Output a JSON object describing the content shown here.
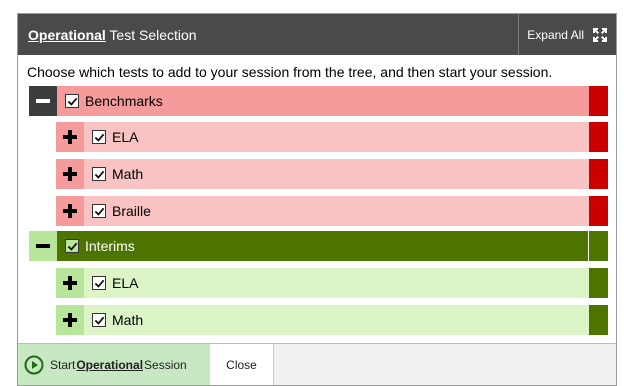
{
  "header": {
    "title_emphasis": "Operational",
    "title_rest": " Test Selection",
    "expand_all_label": "Expand All",
    "expand_icon": "expand-icon"
  },
  "instructions": "Choose which tests to add to your session from the tree, and then start your session.",
  "tree": {
    "benchmarks": {
      "label": "Benchmarks",
      "checked": true,
      "expanded": true,
      "colors": {
        "row": "#f59b9b",
        "toggle": "#3c3c3c",
        "endcap": "#cc0000"
      },
      "children": [
        {
          "label": "ELA",
          "checked": true,
          "expanded": false
        },
        {
          "label": "Math",
          "checked": true,
          "expanded": false
        },
        {
          "label": "Braille",
          "checked": true,
          "expanded": false
        }
      ],
      "child_colors": {
        "row": "#fac3c3",
        "toggle": "#f59b9b",
        "endcap": "#cc0000"
      }
    },
    "interims": {
      "label": "Interims",
      "checked": true,
      "expanded": true,
      "colors": {
        "row": "#4d7400",
        "toggle": "#b7e59a",
        "endcap": "#4d7400"
      },
      "children": [
        {
          "label": "ELA",
          "checked": true,
          "expanded": false
        },
        {
          "label": "Math",
          "checked": true,
          "expanded": false
        }
      ],
      "child_colors": {
        "row": "#ddf4c7",
        "toggle": "#b7e59a",
        "endcap": "#4d7400"
      }
    }
  },
  "footer": {
    "start_prefix": "Start ",
    "start_emphasis": "Operational",
    "start_suffix": " Session",
    "close_label": "Close",
    "start_icon": "play-circle-icon"
  }
}
